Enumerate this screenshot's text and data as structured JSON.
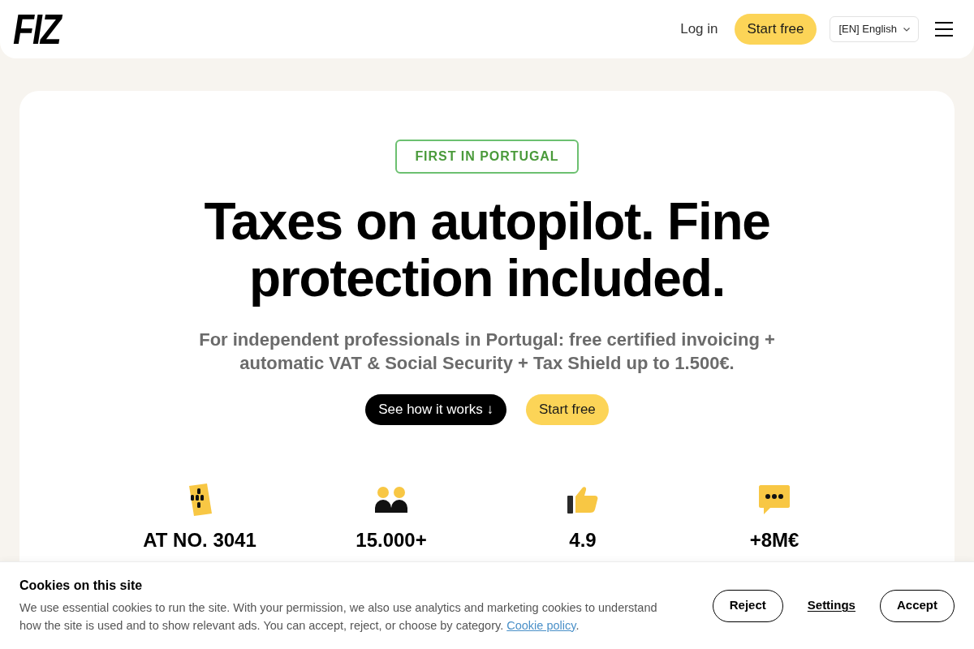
{
  "header": {
    "logo": "FIZ",
    "nav": [
      {
        "label": "Log in",
        "kind": "link"
      },
      {
        "label": "Start free",
        "kind": "primary"
      }
    ],
    "language": {
      "value": "[EN] English"
    }
  },
  "hero": {
    "badge": "FIRST IN PORTUGAL",
    "title": "Taxes on autopilot. Fine protection included.",
    "subtitle": "For independent professionals in Portugal: free certified invoicing + automatic VAT & Social Security + Tax Shield up to 1.500€.",
    "buttons": [
      {
        "label": "See how it works ↓",
        "kind": "dark"
      },
      {
        "label": "Start free",
        "kind": "primary"
      }
    ]
  },
  "stats": [
    {
      "value": "AT NO. 3041"
    },
    {
      "value": "15.000+"
    },
    {
      "value": "4.9"
    },
    {
      "value": "+8M€"
    }
  ],
  "cookie_banner": {
    "title": "Cookies on this site",
    "text": "We use essential cookies to run the site. With your permission, we also use analytics and marketing cookies to understand how the site is used and to show relevant ads. You can accept, reject, or choose by category.",
    "link": "Cookie policy",
    "link_suffix": ".",
    "buttons": [
      {
        "label": "Reject",
        "kind": "outline"
      },
      {
        "label": "Settings",
        "kind": "text"
      },
      {
        "label": "Accept",
        "kind": "outline"
      }
    ]
  }
}
